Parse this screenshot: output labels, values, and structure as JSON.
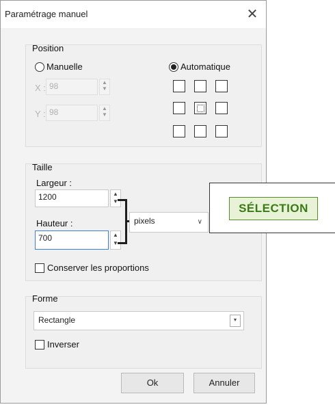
{
  "dialog": {
    "title": "Paramétrage manuel",
    "close_glyph": "✕"
  },
  "position": {
    "group_label": "Position",
    "manual_label": "Manuelle",
    "automatic_label": "Automatique",
    "selected_mode": "Automatique",
    "x_label": "X :",
    "x_value": "98",
    "y_label": "Y :",
    "y_value": "98",
    "anchor_selected": "center"
  },
  "size": {
    "group_label": "Taille",
    "width_label": "Largeur :",
    "width_value": "1200",
    "height_label": "Hauteur :",
    "height_value": "700",
    "unit_value": "pixels",
    "keep_ratio_label": "Conserver les proportions",
    "keep_ratio_checked": false
  },
  "shape": {
    "group_label": "Forme",
    "shape_value": "Rectangle",
    "invert_label": "Inverser",
    "invert_checked": false
  },
  "buttons": {
    "ok_label": "Ok",
    "cancel_label": "Annuler"
  },
  "callout": {
    "label": "SÉLECTION",
    "color": "#3a7a14"
  },
  "icons": {
    "close": "close-icon",
    "spin": "spinner-arrows-icon",
    "dropdown": "chevron-down-icon"
  }
}
